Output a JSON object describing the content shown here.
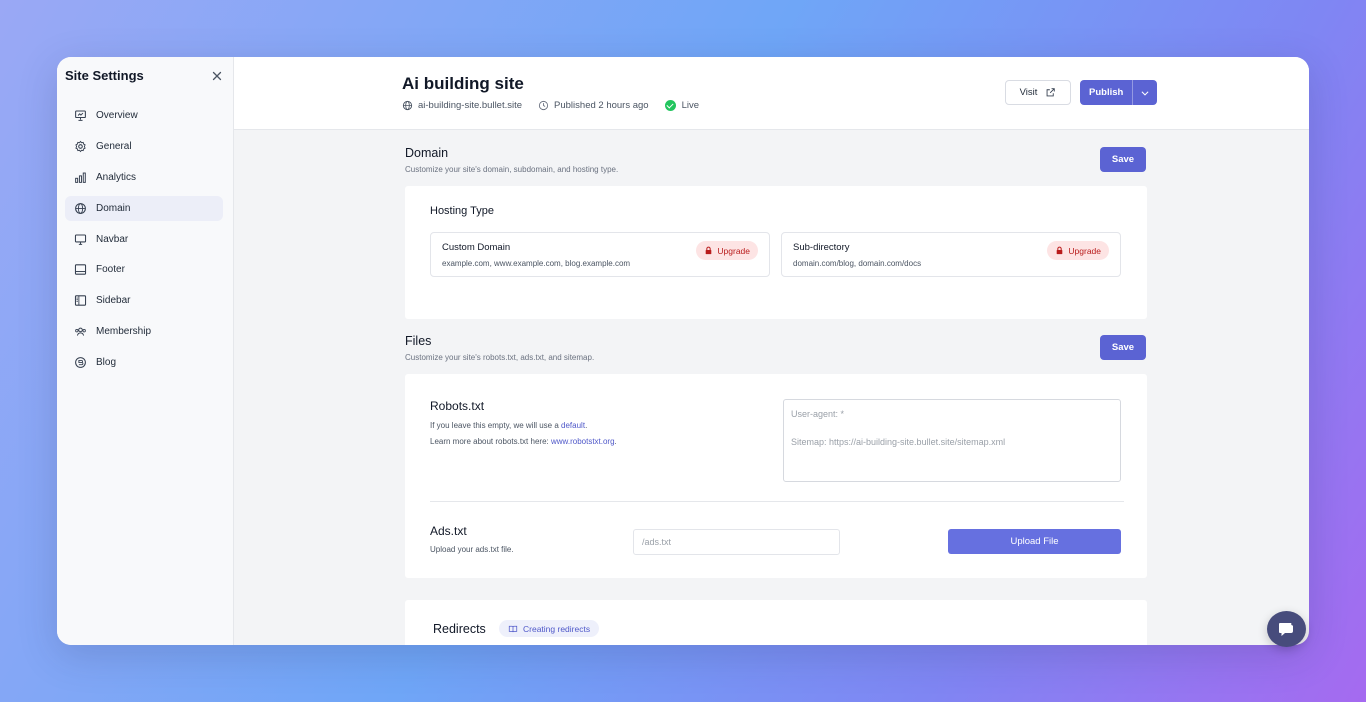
{
  "sidebar": {
    "title": "Site Settings",
    "items": [
      {
        "label": "Overview",
        "icon": "presentation-icon"
      },
      {
        "label": "General",
        "icon": "gear-icon"
      },
      {
        "label": "Analytics",
        "icon": "bar-chart-icon"
      },
      {
        "label": "Domain",
        "icon": "globe-icon",
        "active": true
      },
      {
        "label": "Navbar",
        "icon": "monitor-icon"
      },
      {
        "label": "Footer",
        "icon": "footer-layout-icon"
      },
      {
        "label": "Sidebar",
        "icon": "sidebar-layout-icon"
      },
      {
        "label": "Membership",
        "icon": "users-icon"
      },
      {
        "label": "Blog",
        "icon": "blog-icon"
      }
    ]
  },
  "header": {
    "title": "Ai building site",
    "domain": "ai-building-site.bullet.site",
    "published": "Published 2 hours ago",
    "status": "Live",
    "visit_label": "Visit",
    "publish_label": "Publish"
  },
  "domain_section": {
    "title": "Domain",
    "subtitle": "Customize your site's domain, subdomain, and hosting type.",
    "save_label": "Save",
    "hosting_type_label": "Hosting Type",
    "options": [
      {
        "title": "Custom Domain",
        "desc": "example.com, www.example.com, blog.example.com",
        "badge": "Upgrade"
      },
      {
        "title": "Sub-directory",
        "desc": "domain.com/blog, domain.com/docs",
        "badge": "Upgrade"
      }
    ]
  },
  "files_section": {
    "title": "Files",
    "subtitle": "Customize your site's robots.txt, ads.txt, and sitemap.",
    "save_label": "Save",
    "robots": {
      "title": "Robots.txt",
      "help1_prefix": "If you leave this empty, we will use a ",
      "help1_link": "default",
      "help1_suffix": ".",
      "help2_prefix": "Learn more about robots.txt here: ",
      "help2_link": "www.robotstxt.org",
      "help2_suffix": ".",
      "placeholder": "User-agent: *\n\nSitemap: https://ai-building-site.bullet.site/sitemap.xml"
    },
    "ads": {
      "title": "Ads.txt",
      "help": "Upload your ads.txt file.",
      "input_placeholder": "/ads.txt",
      "upload_label": "Upload File"
    }
  },
  "redirects_section": {
    "title": "Redirects",
    "tag_label": "Creating redirects"
  },
  "colors": {
    "accent": "#5b63d3",
    "upgrade_bg": "#fde4e4",
    "upgrade_text": "#b91c1c",
    "live": "#22c55e"
  }
}
